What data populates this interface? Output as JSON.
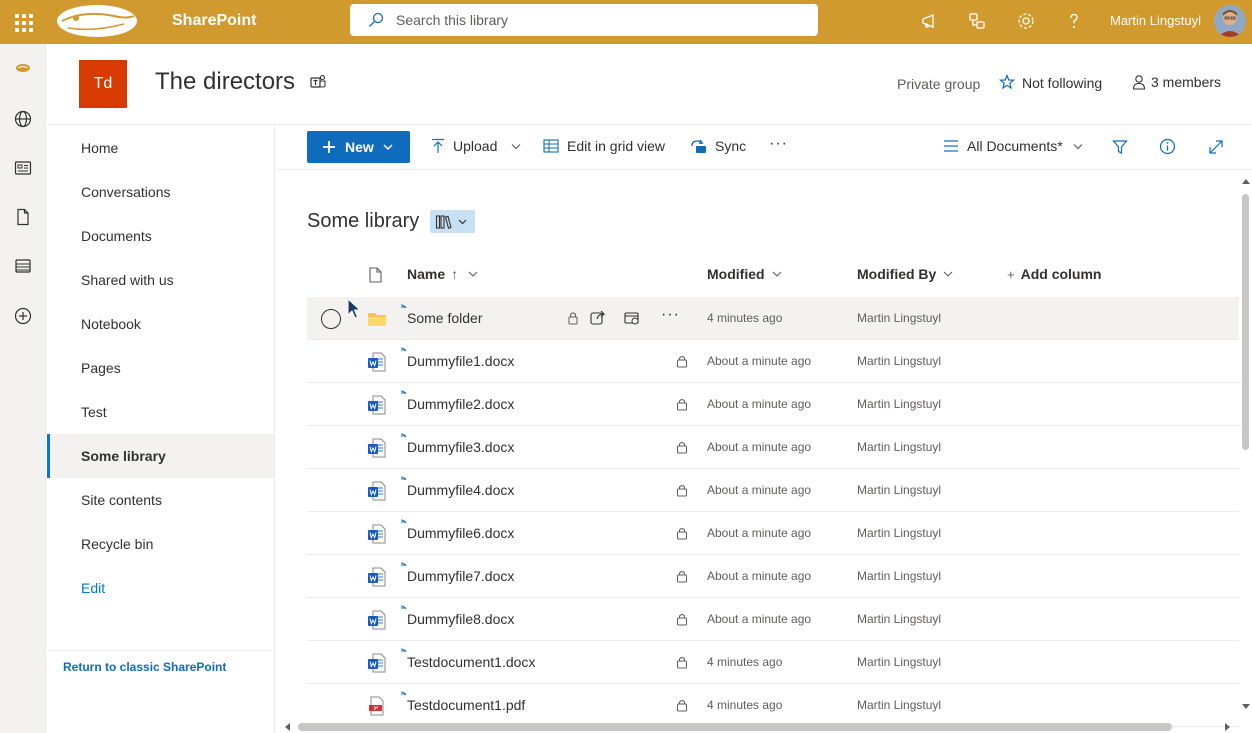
{
  "topbar": {
    "app_name": "SharePoint",
    "search_placeholder": "Search this library",
    "user_name": "Martin Lingstuyl"
  },
  "site": {
    "logo_initials": "Td",
    "title": "The directors",
    "privacy": "Private group",
    "follow_label": "Not following",
    "members_label": "3 members"
  },
  "nav": {
    "items": [
      {
        "label": "Home"
      },
      {
        "label": "Conversations"
      },
      {
        "label": "Documents"
      },
      {
        "label": "Shared with us"
      },
      {
        "label": "Notebook"
      },
      {
        "label": "Pages"
      },
      {
        "label": "Test"
      },
      {
        "label": "Some library"
      },
      {
        "label": "Site contents"
      },
      {
        "label": "Recycle bin"
      },
      {
        "label": "Edit"
      }
    ],
    "active": "Some library",
    "return_classic": "Return to classic SharePoint"
  },
  "commands": {
    "new": "New",
    "upload": "Upload",
    "grid": "Edit in grid view",
    "sync": "Sync",
    "more": "···",
    "view": "All Documents*"
  },
  "library": {
    "title": "Some library",
    "columns": {
      "name": "Name",
      "name_sort": "↑",
      "modified": "Modified",
      "modified_by": "Modified By",
      "add_column": "Add column",
      "add_plus": "+"
    },
    "rows": [
      {
        "name": "Some folder",
        "type": "folder",
        "modified": "4 minutes ago",
        "modified_by": "Martin Lingstuyl"
      },
      {
        "name": "Dummyfile1.docx",
        "type": "docx",
        "modified": "About a minute ago",
        "modified_by": "Martin Lingstuyl"
      },
      {
        "name": "Dummyfile2.docx",
        "type": "docx",
        "modified": "About a minute ago",
        "modified_by": "Martin Lingstuyl"
      },
      {
        "name": "Dummyfile3.docx",
        "type": "docx",
        "modified": "About a minute ago",
        "modified_by": "Martin Lingstuyl"
      },
      {
        "name": "Dummyfile4.docx",
        "type": "docx",
        "modified": "About a minute ago",
        "modified_by": "Martin Lingstuyl"
      },
      {
        "name": "Dummyfile6.docx",
        "type": "docx",
        "modified": "About a minute ago",
        "modified_by": "Martin Lingstuyl"
      },
      {
        "name": "Dummyfile7.docx",
        "type": "docx",
        "modified": "About a minute ago",
        "modified_by": "Martin Lingstuyl"
      },
      {
        "name": "Dummyfile8.docx",
        "type": "docx",
        "modified": "About a minute ago",
        "modified_by": "Martin Lingstuyl"
      },
      {
        "name": "Testdocument1.docx",
        "type": "docx",
        "modified": "4 minutes ago",
        "modified_by": "Martin Lingstuyl"
      },
      {
        "name": "Testdocument1.pdf",
        "type": "pdf",
        "modified": "4 minutes ago",
        "modified_by": "Martin Lingstuyl"
      }
    ]
  },
  "colors": {
    "suite_bar": "#d19a2e",
    "accent": "#0f6cbd",
    "site_logo": "#d83b01"
  },
  "icons": {
    "waffle": "app-launcher-icon",
    "search": "search-icon",
    "megaphone": "megaphone-icon",
    "share": "share-icon",
    "settings": "gear-icon",
    "help": "help-icon",
    "teams": "teams-icon",
    "star": "star-icon",
    "person": "person-icon",
    "filter": "filter-icon",
    "info": "info-icon",
    "expand": "expand-icon"
  }
}
